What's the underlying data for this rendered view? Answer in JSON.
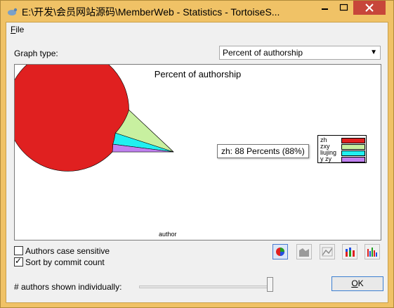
{
  "window": {
    "title": "E:\\开发\\会员网站源码\\MemberWeb - Statistics - TortoiseS...",
    "buttons": {
      "minimize": "minimize-icon",
      "maximize": "maximize-icon",
      "close": "close-icon"
    }
  },
  "menu": {
    "file_mnemonic": "F",
    "file_rest": "ile"
  },
  "controls": {
    "graph_type_label": "Graph type:",
    "graph_type_value": "Percent of authorship",
    "authors_case_sensitive": {
      "label": "Authors case sensitive",
      "checked": false
    },
    "sort_by_commit_count": {
      "label": "Sort by commit count",
      "checked": true
    },
    "authors_shown_label": "# authors shown individually:",
    "authors_shown_slider_fraction": 1.0,
    "ok_mnemonic": "O",
    "ok_rest": "K"
  },
  "toolbar": [
    {
      "name": "pie-chart-button",
      "icon": "pie-chart-icon",
      "active": true
    },
    {
      "name": "area-chart-button",
      "icon": "area-chart-icon",
      "active": false
    },
    {
      "name": "line-chart-button",
      "icon": "line-chart-icon",
      "active": false
    },
    {
      "name": "stacked-bar-chart-button",
      "icon": "stacked-bar-icon",
      "active": false
    },
    {
      "name": "bar-chart-button",
      "icon": "bar-chart-icon",
      "active": false
    }
  ],
  "tooltip": "zh: 88 Percents (88%)",
  "chart_data": {
    "type": "pie",
    "title": "Percent of authorship",
    "xlabel": "author",
    "legend_position": "right",
    "categories": [
      "zh",
      "zxy",
      "liujing",
      "y zy"
    ],
    "values": [
      88,
      7,
      3,
      2
    ],
    "colors": [
      "#e02020",
      "#c8f0a0",
      "#20f0f0",
      "#c080f0"
    ]
  }
}
